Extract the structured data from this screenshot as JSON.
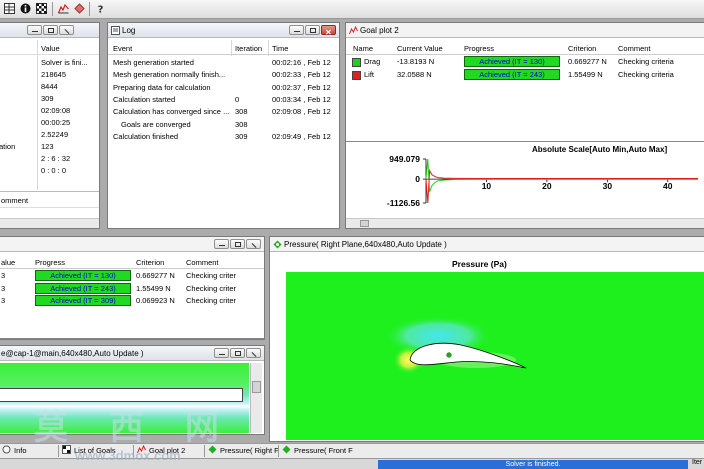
{
  "toolbar": {
    "icons": [
      "table-icon",
      "info-icon",
      "checkered-flag-icon",
      "chart-icon",
      "diamond-icon",
      "help-icon"
    ]
  },
  "info_panel": {
    "headers": {
      "value": "Value"
    },
    "values": [
      "Solver is fini...",
      "218645",
      "8444",
      "309",
      "02:09:08",
      "00:00:25",
      "2.52249",
      "123",
      "2 : 6 : 32",
      "0 : 0 : 0"
    ],
    "partial_label": "ation",
    "comment_header": "omment"
  },
  "log_panel": {
    "title": "Log",
    "headers": {
      "event": "Event",
      "iteration": "Iteration",
      "time": "Time"
    },
    "rows": [
      {
        "event": "Mesh generation started",
        "iteration": "",
        "time": "00:02:16 , Feb 12"
      },
      {
        "event": "Mesh generation normally finish...",
        "iteration": "",
        "time": "00:02:33 , Feb 12"
      },
      {
        "event": "Preparing data for calculation",
        "iteration": "",
        "time": "00:02:37 , Feb 12"
      },
      {
        "event": "Calculation started",
        "iteration": "0",
        "time": "00:03:34 , Feb 12"
      },
      {
        "event": "Calculation has converged since ...",
        "iteration": "308",
        "time": "02:09:08 , Feb 12"
      },
      {
        "event": "Goals are converged",
        "iteration": "308",
        "time": ""
      },
      {
        "event": "Calculation finished",
        "iteration": "309",
        "time": "02:09:49 , Feb 12"
      }
    ]
  },
  "goal_plot": {
    "title": "Goal plot 2",
    "headers": {
      "name": "Name",
      "current": "Current Value",
      "progress": "Progress",
      "criterion": "Criterion",
      "comment": "Comment"
    },
    "rows": [
      {
        "name": "Drag",
        "color": "#22cc22",
        "current": "-13.8193 N",
        "progress": "Achieved (IT = 130)",
        "criterion": "0.669277 N",
        "comment": "Checking criteria"
      },
      {
        "name": "Lift",
        "color": "#e02020",
        "current": "32.0588 N",
        "progress": "Achieved (IT = 243)",
        "criterion": "1.55499 N",
        "comment": "Checking criteria"
      }
    ]
  },
  "chart_data": {
    "type": "line",
    "title": "Absolute Scale[Auto Min,Auto Max]",
    "y_ticks": [
      "949.079",
      "0",
      "-1126.56"
    ],
    "x_ticks": [
      "10",
      "20",
      "30",
      "40"
    ],
    "ylim": [
      -1126.56,
      949.079
    ],
    "xlim": [
      0,
      45
    ],
    "series": [
      {
        "color": "#22cc22",
        "x": [
          0,
          0.3,
          0.6,
          1,
          1.5,
          2,
          3,
          5,
          10,
          20,
          30,
          45
        ],
        "y": [
          0,
          949.079,
          -600,
          -300,
          -150,
          -80,
          -40,
          -20,
          -15,
          -14,
          -14,
          -13.8
        ]
      },
      {
        "color": "#e02020",
        "x": [
          0,
          0.3,
          0.6,
          1,
          1.5,
          2,
          3,
          5,
          10,
          20,
          30,
          45
        ],
        "y": [
          0,
          -1126.56,
          400,
          200,
          120,
          70,
          45,
          35,
          32,
          32,
          32,
          32
        ]
      }
    ]
  },
  "goals_panel": {
    "headers": {
      "value": "alue",
      "progress": "Progress",
      "criterion": "Criterion",
      "comment": "Comment"
    },
    "rows": [
      {
        "value": "3",
        "progress": "Achieved (IT = 130)",
        "criterion": "0.669277 N",
        "comment": "Checking criter"
      },
      {
        "value": "3",
        "progress": "Achieved (IT = 243)",
        "criterion": "1.55499 N",
        "comment": "Checking criter"
      },
      {
        "value": "3",
        "progress": "Achieved (IT = 309)",
        "criterion": "0.069923 N",
        "comment": "Checking criter"
      }
    ]
  },
  "cut_plot_panel": {
    "title": "e@cap-1@main,640x480,Auto Update )"
  },
  "pressure_panel": {
    "title": "Pressure( Right Plane,640x480,Auto Update )",
    "plot_title": "Pressure (Pa)",
    "colors": {
      "field": "#1ef01e"
    }
  },
  "taskbar": {
    "tabs": [
      "Info",
      "List of Goals",
      "Goal plot 2",
      "Pressure( Right F",
      "Pressure( Front F"
    ],
    "status": "Solver is finished.",
    "corner": "Iter"
  },
  "watermark": {
    "text": "莫 西 网",
    "url": "www.3dmox.com"
  }
}
